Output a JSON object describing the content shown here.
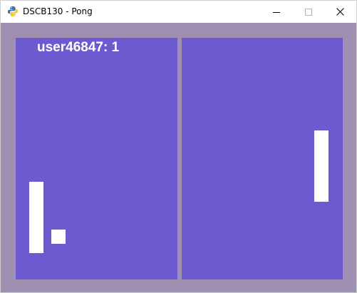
{
  "window": {
    "title": "DSCB130 - Pong",
    "app_icon": "python-icon"
  },
  "controls": {
    "minimize_icon": "minimize-icon",
    "maximize_icon": "maximize-icon",
    "close_icon": "close-icon"
  },
  "game": {
    "score_text": "user46847: 1",
    "colors": {
      "border": "#9f8fb0",
      "court": "#6d5ad1",
      "pieces": "#ffffff"
    }
  }
}
